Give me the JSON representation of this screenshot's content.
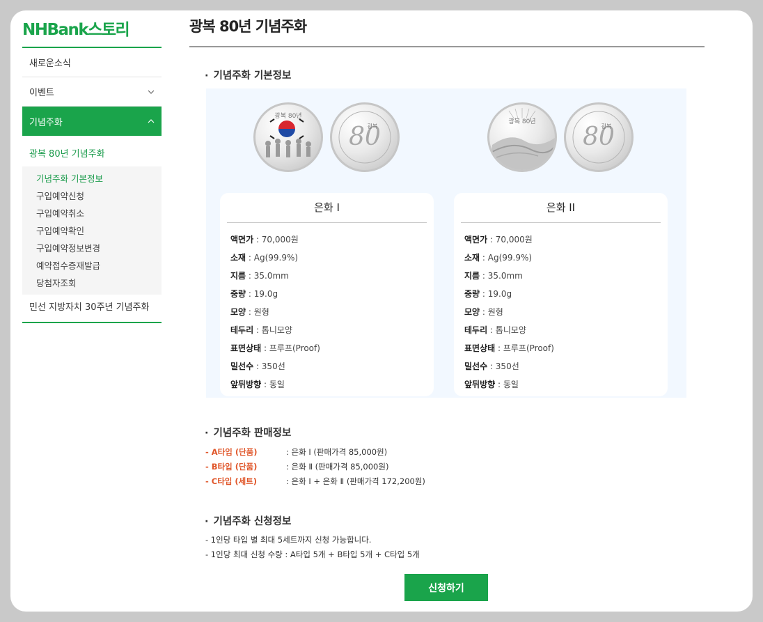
{
  "logo": "NHBank스토리",
  "sidebar": {
    "items": [
      {
        "label": "새로운소식"
      },
      {
        "label": "이벤트",
        "chevron": "chevron-down-icon"
      },
      {
        "label": "기념주화",
        "chevron": "chevron-up-icon"
      }
    ],
    "sub_title": "광복 80년 기념주화",
    "sub_items": [
      "기념주화 기본정보",
      "구입예약신청",
      "구입예약취소",
      "구입예약확인",
      "구입예약정보변경",
      "예약접수증재발급",
      "당첨자조회"
    ],
    "extra_item": "민선 지방자치 30주년 기념주화"
  },
  "page": {
    "title": "광복 80년 기념주화"
  },
  "sections": {
    "basic": "기념주화 기본정보",
    "sale": "기념주화 판매정보",
    "apply": "기념주화 신청정보"
  },
  "coins": [
    {
      "name": "은화 I",
      "front_text": "광복 80년",
      "specs": [
        {
          "k": "액면가",
          "v": "70,000원"
        },
        {
          "k": "소재",
          "v": "Ag(99.9%)"
        },
        {
          "k": "지름",
          "v": "35.0mm"
        },
        {
          "k": "중량",
          "v": "19.0g"
        },
        {
          "k": "모양",
          "v": "원형"
        },
        {
          "k": "테두리",
          "v": "톱니모양"
        },
        {
          "k": "표면상태",
          "v": "프루프(Proof)"
        },
        {
          "k": "밀선수",
          "v": "350선"
        },
        {
          "k": "앞뒤방향",
          "v": "동일"
        }
      ]
    },
    {
      "name": "은화 II",
      "front_text": "광복 80년",
      "specs": [
        {
          "k": "액면가",
          "v": "70,000원"
        },
        {
          "k": "소재",
          "v": "Ag(99.9%)"
        },
        {
          "k": "지름",
          "v": "35.0mm"
        },
        {
          "k": "중량",
          "v": "19.0g"
        },
        {
          "k": "모양",
          "v": "원형"
        },
        {
          "k": "테두리",
          "v": "톱니모양"
        },
        {
          "k": "표면상태",
          "v": "프루프(Proof)"
        },
        {
          "k": "밀선수",
          "v": "350선"
        },
        {
          "k": "앞뒤방향",
          "v": "동일"
        }
      ]
    }
  ],
  "coin_back_text": {
    "number": "80",
    "word": "광복"
  },
  "sale_info": [
    {
      "type": "- A타입 (단품)",
      "desc": ": 은화 Ⅰ (판매가격 85,000원)"
    },
    {
      "type": "- B타입 (단품)",
      "desc": ": 은화 Ⅱ (판매가격 85,000원)"
    },
    {
      "type": "- C타입 (세트)",
      "desc": ": 은화 Ⅰ + 은화 Ⅱ (판매가격 172,200원)"
    }
  ],
  "apply_info": [
    "- 1인당 타입 별 최대 5세트까지 신청 가능합니다.",
    "- 1인당 최대 신청 수량 : A타입 5개 + B타입 5개 + C타입 5개"
  ],
  "apply_button": "신청하기"
}
